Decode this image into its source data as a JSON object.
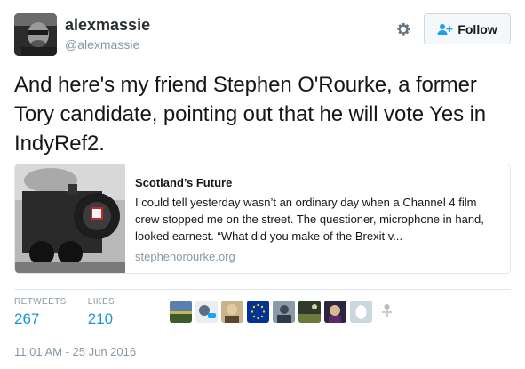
{
  "header": {
    "display_name": "alexmassie",
    "username": "@alexmassie",
    "follow_label": "Follow",
    "gear_icon": "gear-icon",
    "follow_icon": "add-user-icon"
  },
  "tweet": {
    "text": "And here's my friend Stephen O'Rourke, a former Tory candidate, pointing out that he will vote Yes in IndyRef2."
  },
  "card": {
    "title": "Scotland’s Future",
    "description": "I could tell yesterday wasn’t an ordinary day when a Channel 4 film crew stopped me on the street. The questioner, microphone in hand, looked earnest. “What did you make of the Brexit v...",
    "domain": "stephenorourke.org"
  },
  "stats": {
    "retweets_label": "RETWEETS",
    "retweets_value": "267",
    "likes_label": "LIKES",
    "likes_value": "210"
  },
  "likers": [
    "landscape-avatar",
    "person-avatar",
    "portrait-avatar",
    "eu-flag-avatar",
    "photo-avatar",
    "photo-avatar",
    "photo-avatar",
    "egg-avatar",
    "figure-avatar"
  ],
  "timestamp": "11:01 AM - 25 Jun 2016",
  "colors": {
    "link_blue": "#1b95e0",
    "muted": "#8899a6",
    "text": "#14171a",
    "border": "#e1e8ed"
  }
}
